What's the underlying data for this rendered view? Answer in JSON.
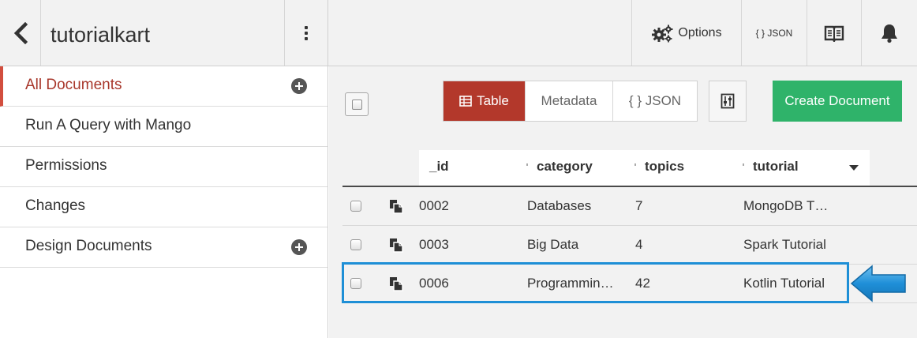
{
  "header": {
    "db_name": "tutorialkart",
    "options_label": "Options",
    "json_label": "{ } JSON",
    "icons": [
      "chevron-left-icon",
      "kebab-menu-icon",
      "gears-icon",
      "open-book-icon",
      "bell-icon"
    ]
  },
  "sidebar": {
    "items": [
      {
        "label": "All Documents",
        "active": true,
        "has_add": true
      },
      {
        "label": "Run A Query with Mango",
        "active": false,
        "has_add": false
      },
      {
        "label": "Permissions",
        "active": false,
        "has_add": false
      },
      {
        "label": "Changes",
        "active": false,
        "has_add": false
      },
      {
        "label": "Design Documents",
        "active": false,
        "has_add": true
      }
    ]
  },
  "toolbar": {
    "view_tabs": [
      {
        "label": "Table",
        "active": true
      },
      {
        "label": "Metadata",
        "active": false
      },
      {
        "label": "{ } JSON",
        "active": false
      }
    ],
    "create_label": "Create Document"
  },
  "table": {
    "columns": [
      "_id",
      "category",
      "topics",
      "tutorial"
    ],
    "rows": [
      {
        "id": "0002",
        "category": "Databases",
        "topics": "7",
        "tutorial": "MongoDB T…"
      },
      {
        "id": "0003",
        "category": "Big Data",
        "topics": "4",
        "tutorial": "Spark Tutorial"
      },
      {
        "id": "0006",
        "category": "Programmin…",
        "topics": "42",
        "tutorial": "Kotlin Tutorial"
      }
    ],
    "highlighted_row_index": 2
  },
  "colors": {
    "accent_red": "#b3382b",
    "active_nav_red": "#a8372b",
    "create_green": "#2fb36a",
    "highlight_blue": "#1e8fd6"
  }
}
